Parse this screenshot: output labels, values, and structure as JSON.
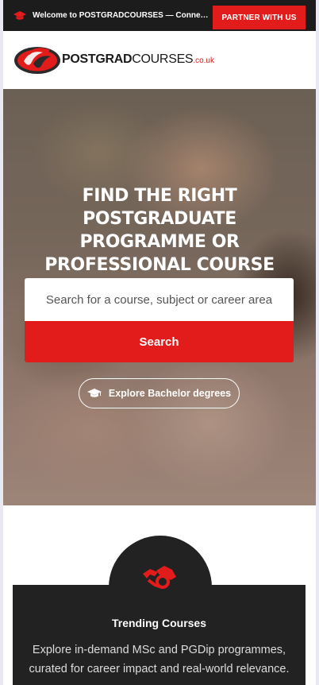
{
  "topbar": {
    "welcome_text": "Welcome to POSTGRADCOURSES — Connecting you with postgraduate study",
    "partner_label": "PARTNER WITH US",
    "icon": "graduation-cap-icon"
  },
  "header": {
    "logo_bold": "POSTGRAD",
    "logo_regular": "COURSES",
    "logo_tld": ".co.uk"
  },
  "hero": {
    "title": "FIND THE RIGHT POSTGRADUATE PROGRAMME OR PROFESSIONAL COURSE",
    "search_placeholder": "Search for a course, subject or career area",
    "search_label": "Search",
    "bachelor_label": "Explore Bachelor degrees"
  },
  "trending": {
    "icon": "trending-hands-icon",
    "title": "Trending Courses",
    "description": "Explore in-demand MSc and PGDip programmes, curated for career impact and real-world relevance."
  },
  "colors": {
    "accent": "#e21b1b",
    "dark": "#1c1c1c",
    "card": "#222222"
  }
}
